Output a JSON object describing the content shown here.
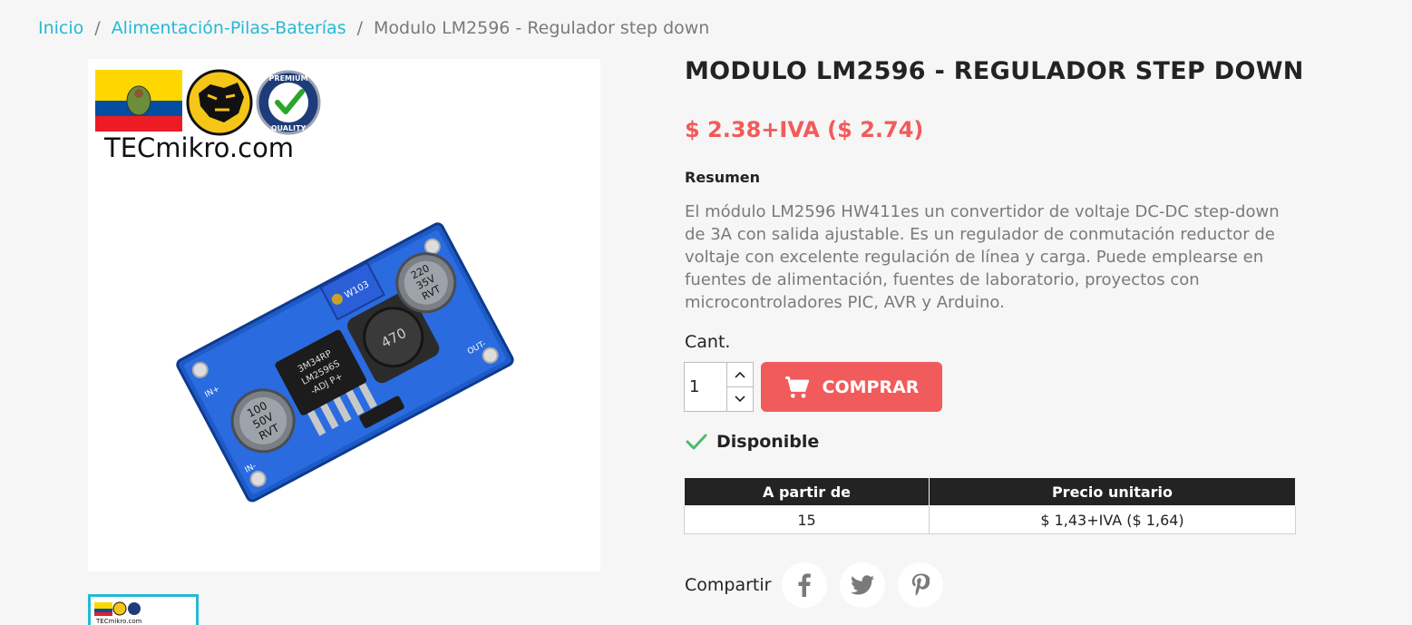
{
  "breadcrumb": {
    "items": [
      {
        "label": "Inicio"
      },
      {
        "label": "Alimentación-Pilas-Baterías"
      }
    ],
    "current": "Modulo LM2596 - Regulador step down",
    "separator": "/"
  },
  "image": {
    "brand": "TECmikro.com",
    "badge_top": "PREMIUM",
    "badge_bottom": "QUALITY",
    "chip_text_1": "3M34RP",
    "chip_text_2": "LM2596S",
    "chip_text_3": "-ADJ P+",
    "inductor_text": "470",
    "pot_text": "W103",
    "cap_left_1": "100",
    "cap_left_2": "50V",
    "cap_left_3": "RVT",
    "cap_right_1": "220",
    "cap_right_2": "35V",
    "cap_right_3": "RVT",
    "pin_in_plus": "IN+",
    "pin_in_minus": "IN-",
    "pin_out_minus": "OUT-"
  },
  "product": {
    "title": "MODULO LM2596 - REGULADOR STEP DOWN",
    "price": "$ 2.38+IVA ($ 2.74)",
    "summary_label": "Resumen",
    "description": "El módulo LM2596 HW411es un convertidor de voltaje DC-DC step-down de 3A con salida ajustable. Es un regulador de conmutación reductor de voltaje con excelente regulación de línea y carga. Puede emplearse en fuentes de alimentación, fuentes de laboratorio, proyectos con microcontroladores PIC, AVR y Arduino.",
    "qty_label": "Cant.",
    "qty_value": "1",
    "add_to_cart_label": "COMPRAR",
    "availability": "Disponible"
  },
  "discount_table": {
    "headers": [
      "A partir de",
      "Precio unitario"
    ],
    "rows": [
      [
        "15",
        "$ 1,43+IVA ($ 1,64)"
      ]
    ]
  },
  "share": {
    "label": "Compartir",
    "networks": [
      "facebook-icon",
      "twitter-icon",
      "pinterest-icon"
    ]
  },
  "colors": {
    "accent": "#24b9d7",
    "price": "#f15b5b",
    "button": "#f15b5b",
    "available": "#4cbb6c",
    "table_header": "#232323"
  }
}
